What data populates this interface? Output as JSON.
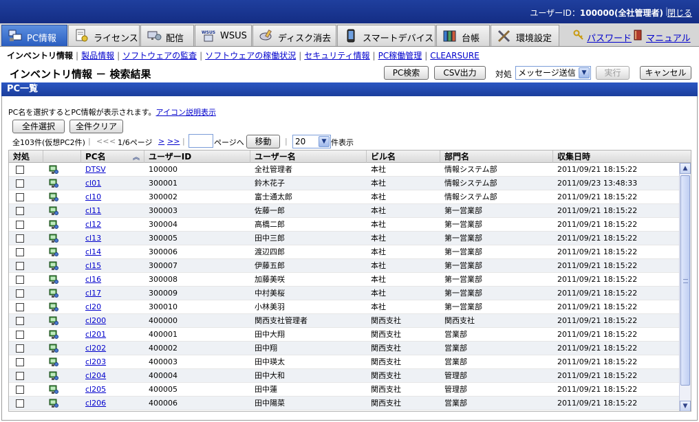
{
  "header": {
    "user_label": "ユーザーID：",
    "user_value": "100000(全社管理者)",
    "separator": "|",
    "logout": "閉じる"
  },
  "tabs": [
    {
      "label": "PC情報",
      "icon": "pc-info-icon",
      "active": true
    },
    {
      "label": "ライセンス",
      "icon": "license-icon",
      "active": false
    },
    {
      "label": "配信",
      "icon": "delivery-icon",
      "active": false
    },
    {
      "label": "WSUS",
      "icon": "wsus-icon",
      "active": false
    },
    {
      "label": "ディスク消去",
      "icon": "disk-erase-icon",
      "active": false
    },
    {
      "label": "スマートデバイス",
      "icon": "smart-device-icon",
      "active": false
    },
    {
      "label": "台帳",
      "icon": "ledger-icon",
      "active": false
    },
    {
      "label": "環境設定",
      "icon": "settings-icon",
      "active": false
    }
  ],
  "right_links": {
    "password": "パスワード",
    "manual": "マニュアル"
  },
  "subnav": {
    "current": "インベントリ情報",
    "divider": "|",
    "links": [
      "製品情報",
      "ソフトウェアの監査",
      "ソフトウェアの稼働状況",
      "セキュリティ情報",
      "PC稼働管理",
      "CLEARSURE"
    ]
  },
  "page_title": "インベントリ情報 － 検索結果",
  "toolbar": {
    "pc_search": "PC検索",
    "csv_output": "CSV出力",
    "action_label": "対処",
    "action_select": "メッセージ送信",
    "execute": "実行",
    "cancel": "キャンセル"
  },
  "panel_title": "PC一覧",
  "note": {
    "text": "PC名を選択するとPC情報が表示されます。",
    "link": "アイコン説明表示"
  },
  "buttons": {
    "select_all": "全件選択",
    "clear_all": "全件クリア"
  },
  "pager": {
    "total": "全103件(仮想PC2件)",
    "sep": "|",
    "first": "<<",
    "prev": "<",
    "page_info": "1/6ページ",
    "next": ">",
    "last": ">>",
    "page_input": "",
    "goto_suffix": "ページへ",
    "move_button": "移動",
    "per_page": "20",
    "per_page_suffix": "件表示"
  },
  "table": {
    "columns": [
      "対処",
      "",
      "PC名",
      "ユーザーID",
      "ユーザー名",
      "ビル名",
      "部門名",
      "収集日時"
    ],
    "rows": [
      {
        "pc": "DTSV",
        "uid": "100000",
        "uname": "全社管理者",
        "building": "本社",
        "dept": "情報システム部",
        "date": "2011/09/21 18:15:22"
      },
      {
        "pc": "cl01",
        "uid": "300001",
        "uname": "鈴木花子",
        "building": "本社",
        "dept": "情報システム部",
        "date": "2011/09/23 13:48:33"
      },
      {
        "pc": "cl10",
        "uid": "300002",
        "uname": "富士通太郎",
        "building": "本社",
        "dept": "情報システム部",
        "date": "2011/09/21 18:15:22"
      },
      {
        "pc": "cl11",
        "uid": "300003",
        "uname": "佐藤一郎",
        "building": "本社",
        "dept": "第一営業部",
        "date": "2011/09/21 18:15:22"
      },
      {
        "pc": "cl12",
        "uid": "300004",
        "uname": "高橋二郎",
        "building": "本社",
        "dept": "第一営業部",
        "date": "2011/09/21 18:15:22"
      },
      {
        "pc": "cl13",
        "uid": "300005",
        "uname": "田中三郎",
        "building": "本社",
        "dept": "第一営業部",
        "date": "2011/09/21 18:15:22"
      },
      {
        "pc": "cl14",
        "uid": "300006",
        "uname": "渡辺四郎",
        "building": "本社",
        "dept": "第一営業部",
        "date": "2011/09/21 18:15:22"
      },
      {
        "pc": "cl15",
        "uid": "300007",
        "uname": "伊藤五郎",
        "building": "本社",
        "dept": "第一営業部",
        "date": "2011/09/21 18:15:22"
      },
      {
        "pc": "cl16",
        "uid": "300008",
        "uname": "加藤美咲",
        "building": "本社",
        "dept": "第一営業部",
        "date": "2011/09/21 18:15:22"
      },
      {
        "pc": "cl17",
        "uid": "300009",
        "uname": "中村美桜",
        "building": "本社",
        "dept": "第一営業部",
        "date": "2011/09/21 18:15:22"
      },
      {
        "pc": "cl20",
        "uid": "300010",
        "uname": "小林美羽",
        "building": "本社",
        "dept": "第一営業部",
        "date": "2011/09/21 18:15:22"
      },
      {
        "pc": "cl200",
        "uid": "400000",
        "uname": "関西支社管理者",
        "building": "関西支社",
        "dept": "関西支社",
        "date": "2011/09/21 18:15:22"
      },
      {
        "pc": "cl201",
        "uid": "400001",
        "uname": "田中大翔",
        "building": "関西支社",
        "dept": "営業部",
        "date": "2011/09/21 18:15:22"
      },
      {
        "pc": "cl202",
        "uid": "400002",
        "uname": "田中翔",
        "building": "関西支社",
        "dept": "営業部",
        "date": "2011/09/21 18:15:22"
      },
      {
        "pc": "cl203",
        "uid": "400003",
        "uname": "田中瑛太",
        "building": "関西支社",
        "dept": "営業部",
        "date": "2011/09/21 18:15:22"
      },
      {
        "pc": "cl204",
        "uid": "400004",
        "uname": "田中大和",
        "building": "関西支社",
        "dept": "管理部",
        "date": "2011/09/21 18:15:22"
      },
      {
        "pc": "cl205",
        "uid": "400005",
        "uname": "田中蓮",
        "building": "関西支社",
        "dept": "管理部",
        "date": "2011/09/21 18:15:22"
      },
      {
        "pc": "cl206",
        "uid": "400006",
        "uname": "田中陽菜",
        "building": "関西支社",
        "dept": "営業部",
        "date": "2011/09/21 18:15:22"
      }
    ]
  },
  "icons": {
    "pc_row": "pc-client-icon",
    "sort": "sort-ascending-icon",
    "scroll_up": "scroll-up-icon",
    "scroll_down": "scroll-down-icon"
  },
  "colors": {
    "header_bg": "#1a3590",
    "active_tab": "#3a6cd0",
    "link": "#0000cc",
    "row_alt": "#eef1f5"
  }
}
